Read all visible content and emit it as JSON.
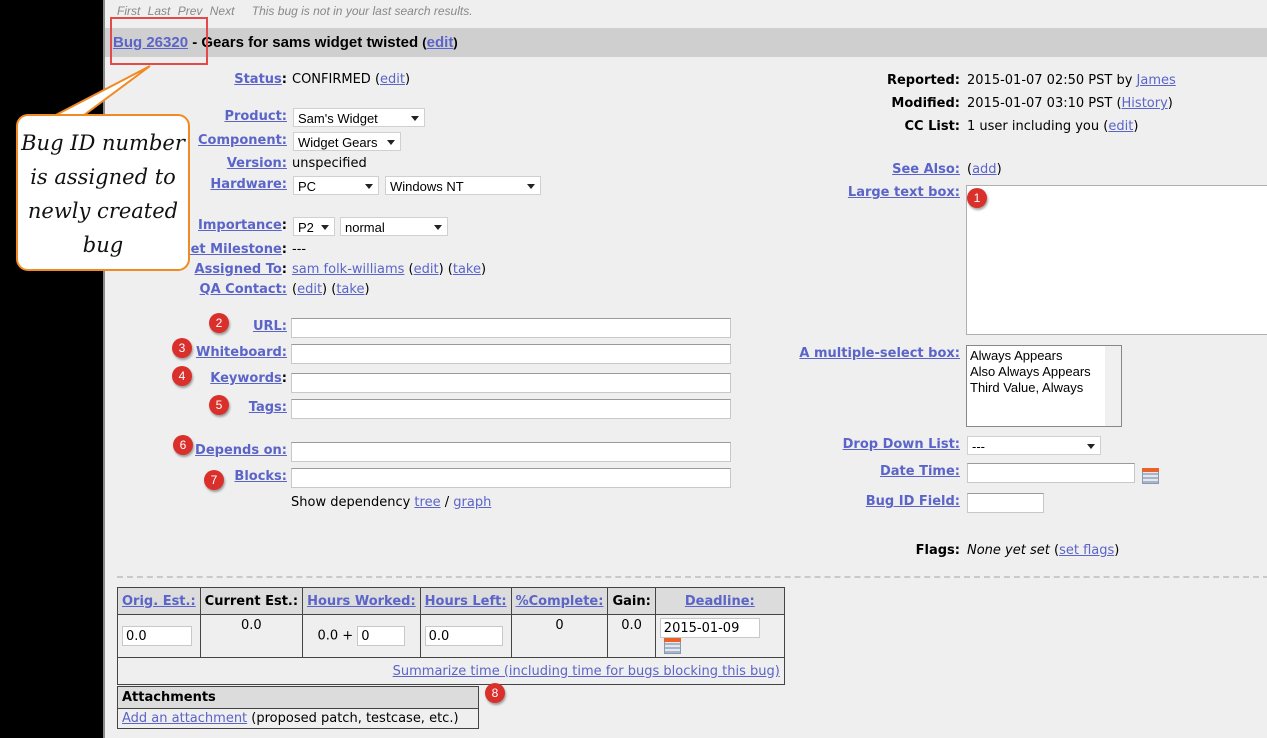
{
  "nav": {
    "first": "First",
    "last": "Last",
    "prev": "Prev",
    "next": "Next",
    "message": "This bug is not in your last search results."
  },
  "bug": {
    "id_link": "Bug 26320",
    "title": "- Gears for sams widget twisted",
    "edit_link": "edit"
  },
  "left": {
    "status": {
      "label": "Status",
      "value": "CONFIRMED",
      "edit": "edit"
    },
    "product": {
      "label": "Product:",
      "value": "Sam's Widget"
    },
    "component": {
      "label": "Component:",
      "value": "Widget Gears"
    },
    "version": {
      "label": "Version:",
      "value": "unspecified"
    },
    "hardware": {
      "label": "Hardware:",
      "platform": "PC",
      "os": "Windows NT"
    },
    "importance": {
      "label": "Importance",
      "priority": "P2",
      "severity": "normal"
    },
    "milestone": {
      "label": "Target Milestone",
      "value": "---"
    },
    "assigned_to": {
      "label": "Assigned To",
      "user": "sam folk-williams",
      "edit": "edit",
      "take": "take"
    },
    "qa_contact": {
      "label": "QA Contact:",
      "edit": "edit",
      "take": "take"
    },
    "url": {
      "label": "URL:",
      "value": ""
    },
    "whiteboard": {
      "label": "Whiteboard:",
      "value": ""
    },
    "keywords": {
      "label": "Keywords",
      "value": ""
    },
    "tags": {
      "label": "Tags:",
      "value": ""
    },
    "depends_on": {
      "label": "Depends on:",
      "value": ""
    },
    "blocks": {
      "label": "Blocks:",
      "value": ""
    },
    "dependency": {
      "text": "Show dependency",
      "tree": "tree",
      "sep": "/",
      "graph": "graph"
    }
  },
  "right": {
    "reported": {
      "label": "Reported:",
      "value": "2015-01-07 02:50 PST by",
      "user": "James"
    },
    "modified": {
      "label": "Modified:",
      "value": "2015-01-07 03:10 PST",
      "history": "History"
    },
    "cc_list": {
      "label": "CC List:",
      "value": "1 user including you",
      "edit": "edit"
    },
    "see_also": {
      "label": "See Also:",
      "add": "add"
    },
    "large_text_box": {
      "label": "Large text box:",
      "value": ""
    },
    "multi_select": {
      "label": "A multiple-select box:",
      "options": [
        "Always Appears",
        "Also Always Appears",
        "Third Value, Always"
      ]
    },
    "drop_down": {
      "label": "Drop Down List:",
      "value": "---"
    },
    "date_time": {
      "label": "Date Time:",
      "value": ""
    },
    "bug_id_field": {
      "label": "Bug ID Field:",
      "value": ""
    },
    "flags": {
      "label": "Flags:",
      "value": "None yet set",
      "set_flags": "set flags"
    }
  },
  "time_table": {
    "headers": {
      "orig_est": "Orig. Est.:",
      "current_est": "Current Est.:",
      "hours_worked": "Hours Worked:",
      "hours_left": "Hours Left:",
      "complete": "%Complete:",
      "gain": "Gain:",
      "deadline": "Deadline:"
    },
    "values": {
      "orig_est": "0.0",
      "current_est": "0.0",
      "hours_worked_prefix": "0.0 +",
      "hours_worked_add": "0",
      "hours_left": "0.0",
      "complete": "0",
      "gain": "0.0",
      "deadline": "2015-01-09"
    },
    "summarize": "Summarize time (including time for bugs blocking this bug)"
  },
  "attachments": {
    "header": "Attachments",
    "add_link": "Add an attachment",
    "hint": "(proposed patch, testcase, etc.)"
  },
  "annotations": {
    "callout": "Bug ID number is assigned to newly created bug",
    "badges": [
      "1",
      "2",
      "3",
      "4",
      "5",
      "6",
      "7",
      "8"
    ],
    "accent_color": "#f08a24",
    "highlight_color": "#e34a4a",
    "badge_color": "#d9302c"
  }
}
